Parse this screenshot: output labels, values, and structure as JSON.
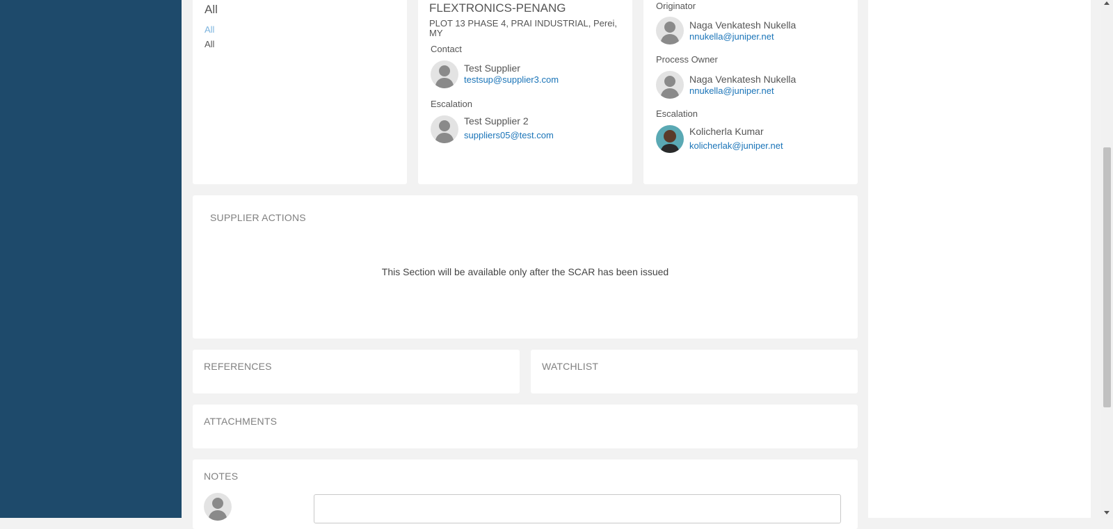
{
  "filter_card": {
    "heading": "All",
    "link": "All",
    "value": "All"
  },
  "supplier_card": {
    "name": "FLEXTRONICS-PENANG",
    "address": "PLOT 13 PHASE 4, PRAI INDUSTRIAL, Perei, MY",
    "contact_label": "Contact",
    "contact_name": "Test Supplier",
    "contact_email": "testsup@supplier3.com",
    "escalation_label": "Escalation",
    "escalation_name": "Test Supplier 2",
    "escalation_email": "suppliers05@test.com"
  },
  "owners_card": {
    "originator_label": "Originator",
    "originator_name": "Naga Venkatesh Nukella",
    "originator_email": "nnukella@juniper.net",
    "process_owner_label": "Process Owner",
    "process_owner_name": "Naga Venkatesh Nukella",
    "process_owner_email": "nnukella@juniper.net",
    "escalation_label": "Escalation",
    "escalation_name": "Kolicherla Kumar",
    "escalation_email": "kolicherlak@juniper.net"
  },
  "supplier_actions": {
    "title": "SUPPLIER ACTIONS",
    "message": "This Section will be available only after the SCAR has been issued"
  },
  "references": {
    "title": "REFERENCES"
  },
  "watchlist": {
    "title": "WATCHLIST"
  },
  "attachments": {
    "title": "ATTACHMENTS"
  },
  "notes": {
    "title": "NOTES",
    "input_value": ""
  },
  "colors": {
    "sidebar": "#1e4a6b",
    "link": "#1a74b8",
    "background": "#f2f2f2"
  }
}
